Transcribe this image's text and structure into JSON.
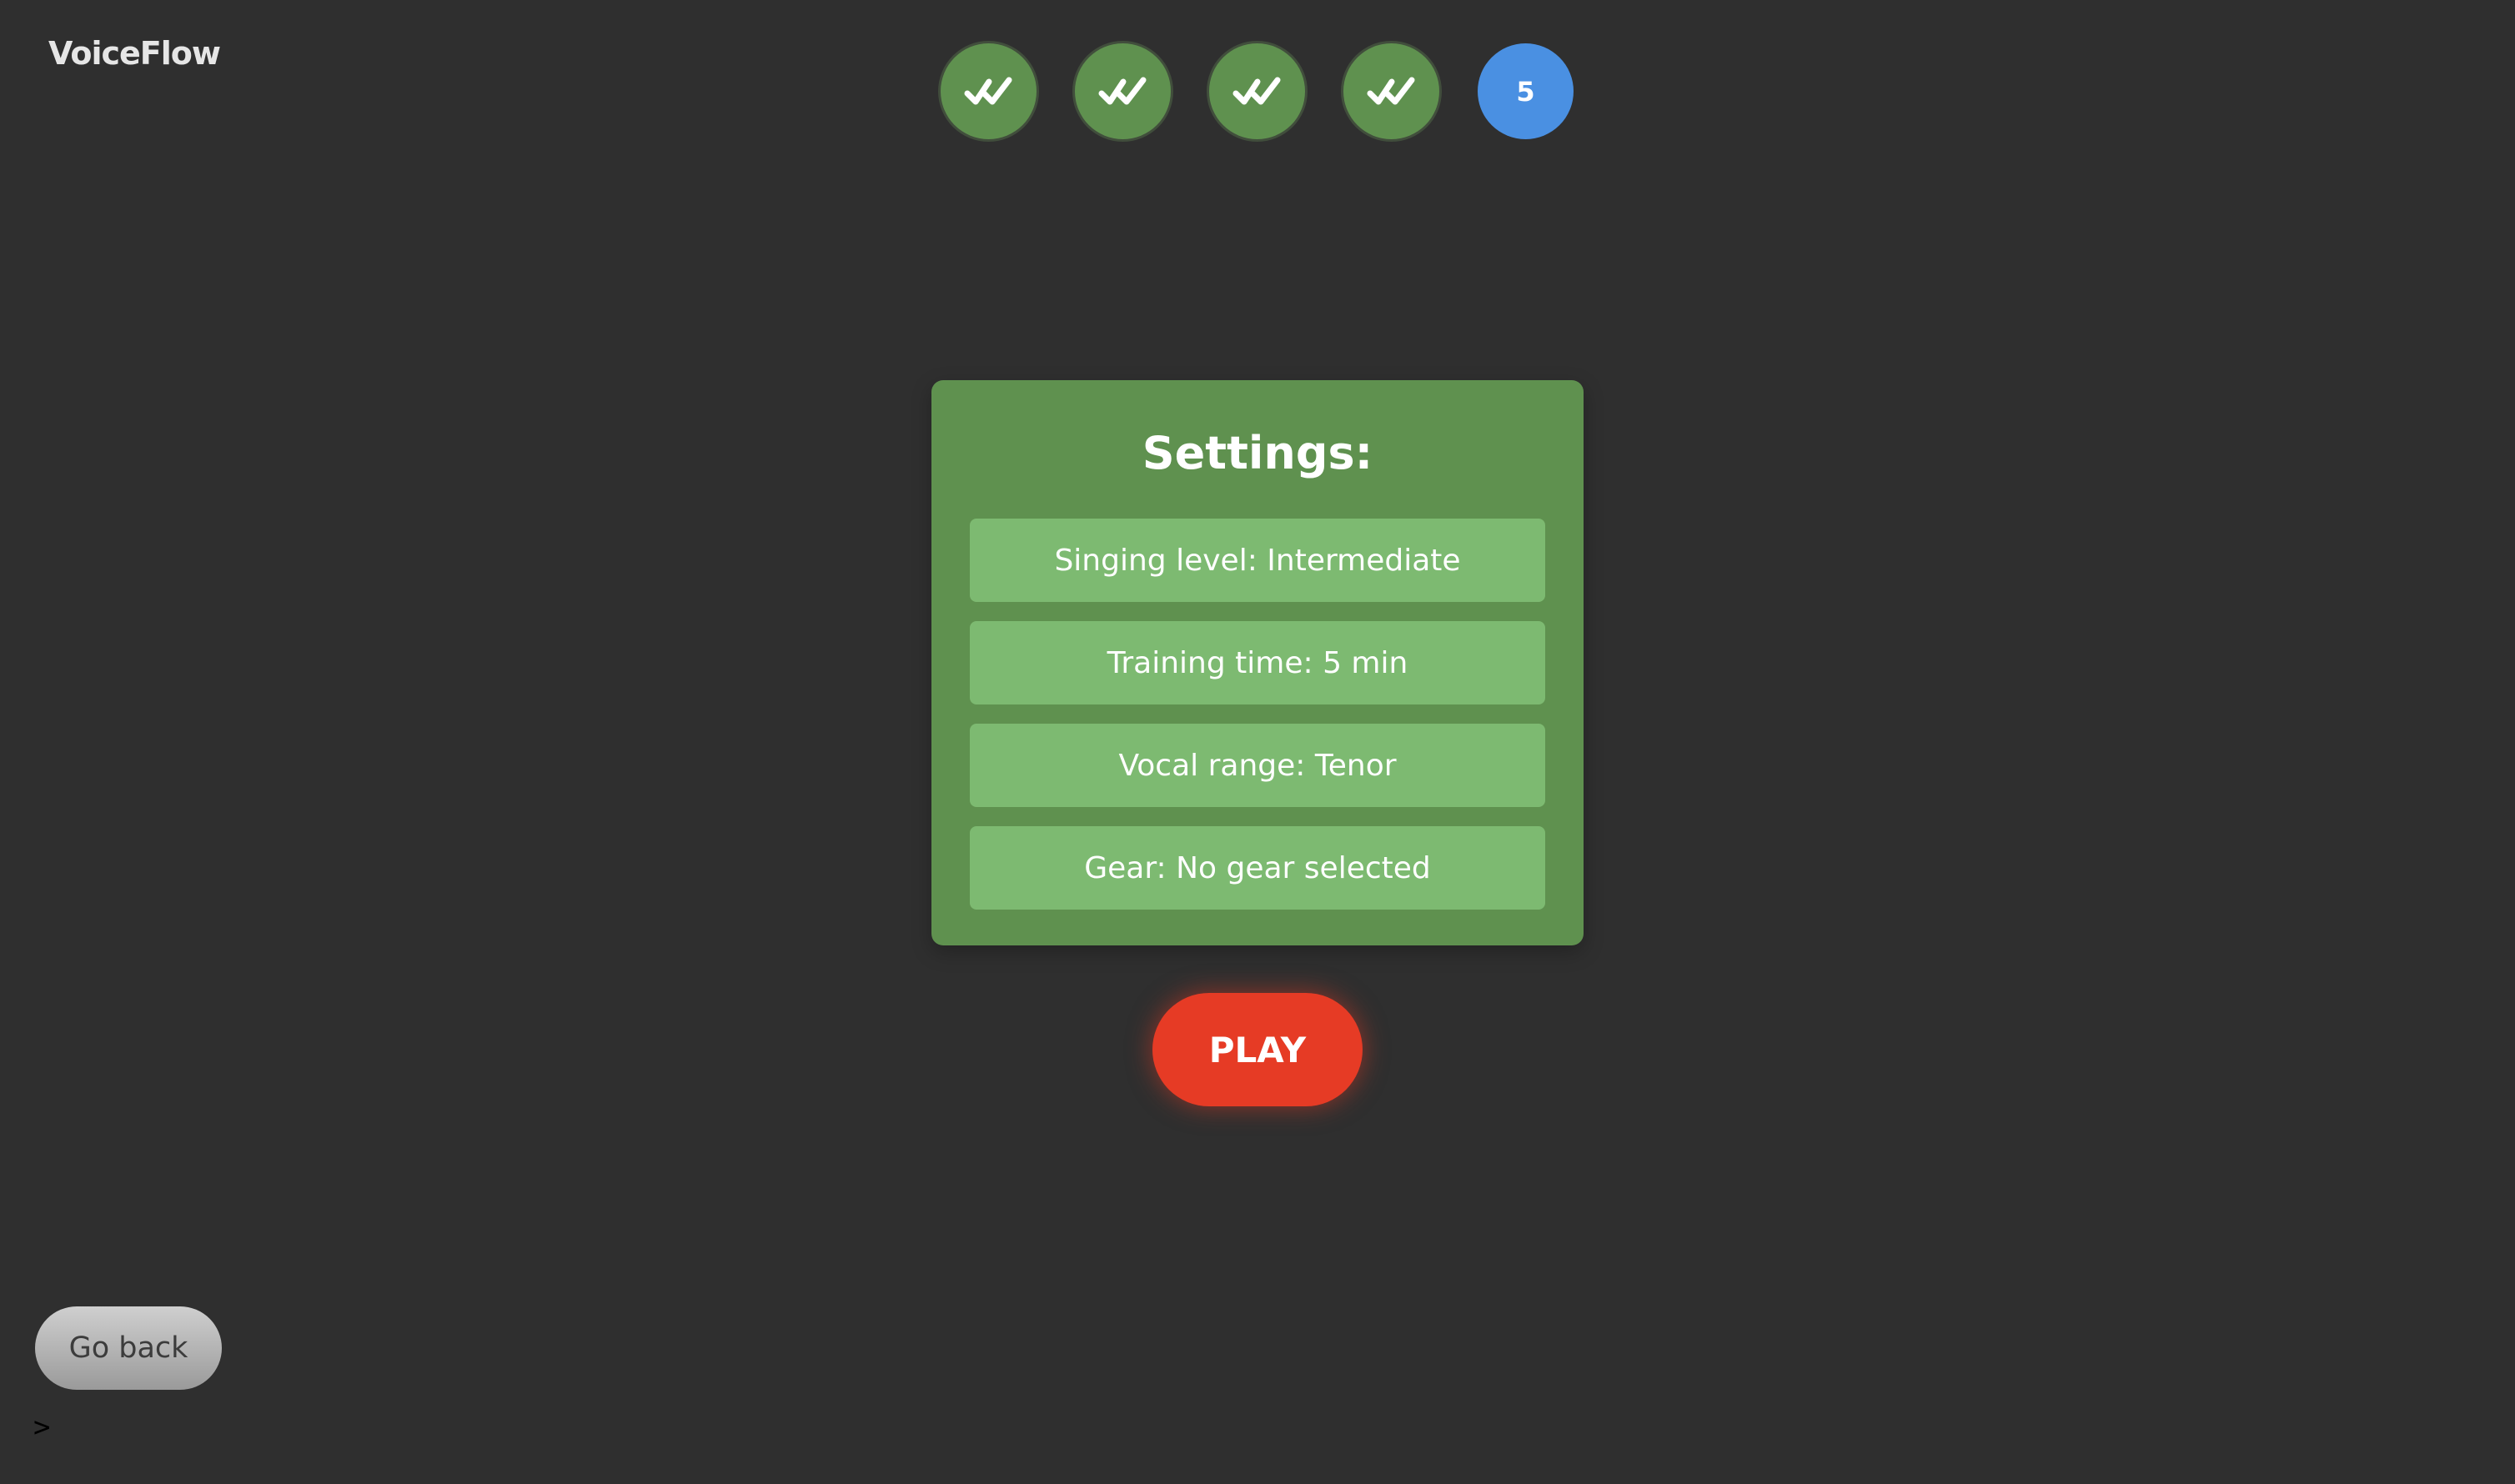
{
  "app": {
    "brand": "VoiceFlow"
  },
  "steps": [
    {
      "status": "done",
      "icon": "double-check-icon"
    },
    {
      "status": "done",
      "icon": "double-check-icon"
    },
    {
      "status": "done",
      "icon": "double-check-icon"
    },
    {
      "status": "done",
      "icon": "double-check-icon"
    },
    {
      "status": "current",
      "label": "5"
    }
  ],
  "settings": {
    "title": "Settings:",
    "items": [
      {
        "label": "Singing level: Intermediate"
      },
      {
        "label": "Training time: 5 min"
      },
      {
        "label": "Vocal range: Tenor"
      },
      {
        "label": "Gear: No gear selected"
      }
    ]
  },
  "actions": {
    "play_label": "PLAY",
    "go_back_label": "Go back"
  },
  "console": {
    "prompt": ">"
  },
  "colors": {
    "background": "#2f2f2f",
    "step_done": "#5f914f",
    "step_current": "#4a90e2",
    "panel": "#5f914f",
    "setting_item": "#7dba71",
    "play": "#e63b25",
    "go_back": "#b4b4b4"
  }
}
